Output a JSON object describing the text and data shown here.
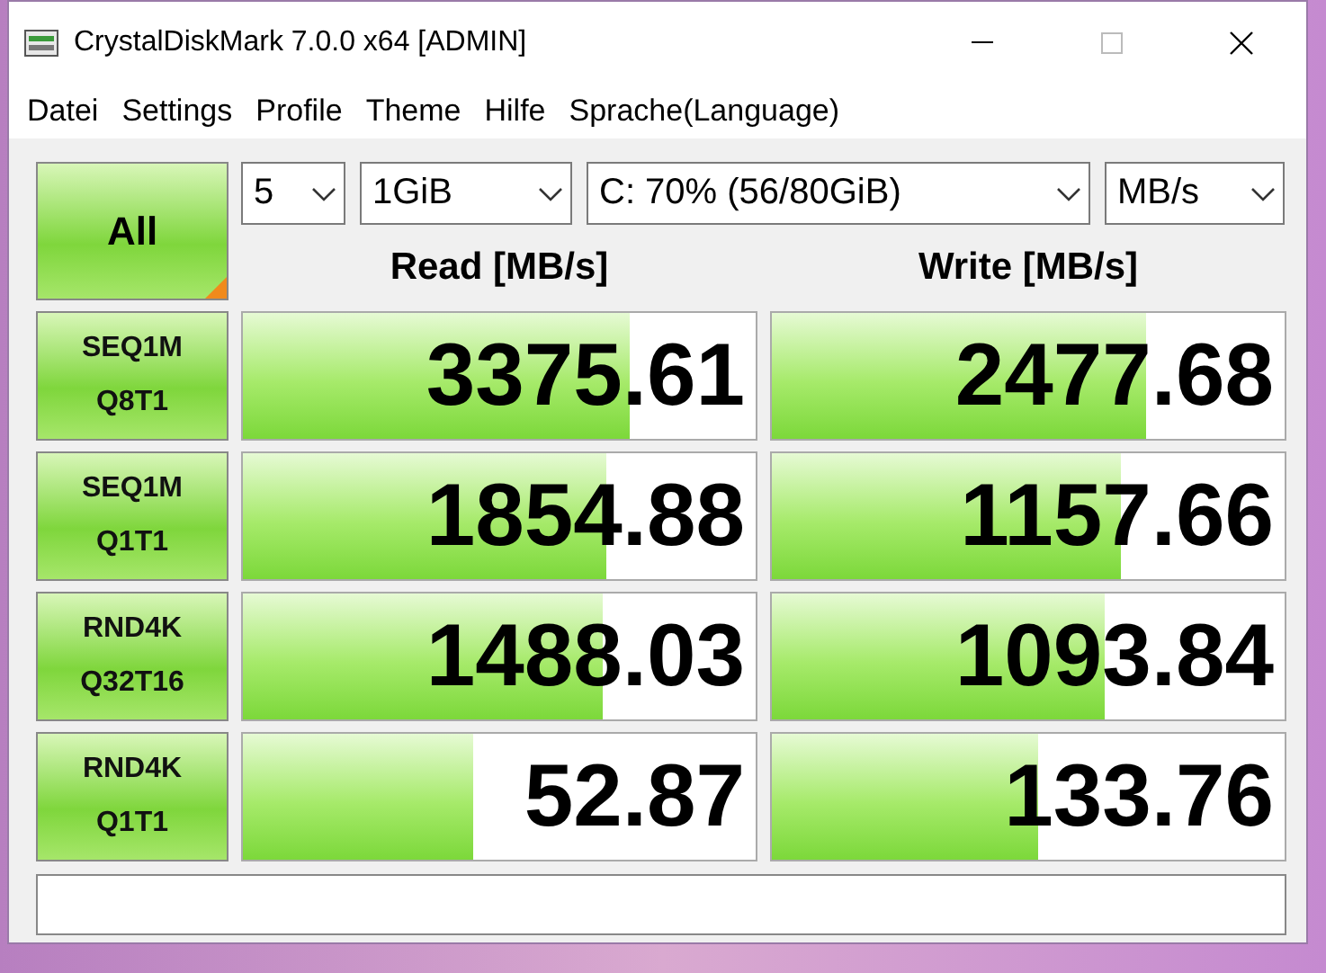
{
  "window": {
    "title": "CrystalDiskMark 7.0.0 x64 [ADMIN]"
  },
  "menu": [
    "Datei",
    "Settings",
    "Profile",
    "Theme",
    "Hilfe",
    "Sprache(Language)"
  ],
  "all_button": {
    "label": "All"
  },
  "selectors": [
    {
      "value": "5"
    },
    {
      "value": "1GiB"
    },
    {
      "value": "C: 70% (56/80GiB)"
    },
    {
      "value": "MB/s"
    }
  ],
  "headers": [
    "Read [MB/s]",
    "Write [MB/s]"
  ],
  "tests": [
    {
      "line1": "SEQ1M",
      "line2": "Q8T1",
      "read": {
        "value": "3375.61",
        "level": 0.755
      },
      "write": {
        "value": "2477.68",
        "level": 0.73
      }
    },
    {
      "line1": "SEQ1M",
      "line2": "Q1T1",
      "read": {
        "value": "1854.88",
        "level": 0.71
      },
      "write": {
        "value": "1157.66",
        "level": 0.68
      }
    },
    {
      "line1": "RND4K",
      "line2": "Q32T16",
      "read": {
        "value": "1488.03",
        "level": 0.7
      },
      "write": {
        "value": "1093.84",
        "level": 0.65
      }
    },
    {
      "line1": "RND4K",
      "line2": "Q1T1",
      "read": {
        "value": "52.87",
        "level": 0.45
      },
      "write": {
        "value": "133.76",
        "level": 0.52
      }
    }
  ]
}
